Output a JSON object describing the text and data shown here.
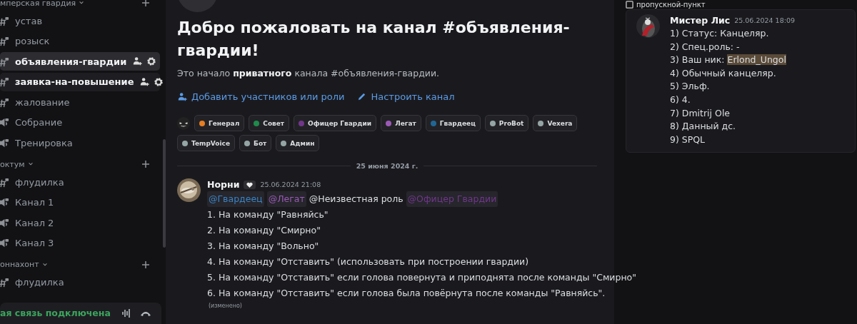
{
  "sidebar": {
    "categories": [
      {
        "name": "мперская гвардия",
        "channels": [
          {
            "kind": "text",
            "name": "устав",
            "selected": false,
            "unread": false
          },
          {
            "kind": "text",
            "name": "розыск",
            "selected": false,
            "unread": false
          },
          {
            "kind": "text",
            "name": "объявления-гвардии",
            "selected": true,
            "unread": true
          },
          {
            "kind": "text",
            "name": "заявка-на-повышение",
            "selected": false,
            "unread": true
          },
          {
            "kind": "text",
            "name": "жалование",
            "selected": false,
            "unread": false
          },
          {
            "kind": "voice",
            "name": "Собрание",
            "selected": false,
            "unread": false
          },
          {
            "kind": "voice",
            "name": "Тренировка",
            "selected": false,
            "unread": false
          }
        ]
      },
      {
        "name": "октум",
        "channels": [
          {
            "kind": "text",
            "name": "флудилка",
            "selected": false,
            "unread": false
          },
          {
            "kind": "voice",
            "name": "Канал 1",
            "selected": false,
            "unread": false
          },
          {
            "kind": "voice",
            "name": "Канал 2",
            "selected": false,
            "unread": false
          },
          {
            "kind": "voice",
            "name": "Канал 3",
            "selected": false,
            "unread": false
          }
        ]
      },
      {
        "name": "оннахонт",
        "channels": [
          {
            "kind": "text",
            "name": "флудилка",
            "selected": false,
            "unread": false
          }
        ]
      }
    ],
    "voice_status": "ая связь подключена"
  },
  "main": {
    "title": "Добро пожаловать на канал #объявления-гвардии!",
    "intro": "Это начало **приватного** канала #объявления-гвардии.",
    "actions": [
      "Добавить участников или роли",
      "Настроить канал"
    ],
    "roles": [
      {
        "name": "Генерал",
        "color": "#e67e22"
      },
      {
        "name": "Совет",
        "color": "#1f8b4c"
      },
      {
        "name": "Офицер Гвардии",
        "color": "#71368a"
      },
      {
        "name": "Легат",
        "color": "#9b59b6"
      },
      {
        "name": "Гвардеец",
        "color": "#206694"
      },
      {
        "name": "ProBot",
        "color": "#95a5a6"
      },
      {
        "name": "Vexera",
        "color": "#95a5a6"
      },
      {
        "name": "TempVoice",
        "color": "#95a5a6"
      },
      {
        "name": "Бот",
        "color": "#95a5a6"
      },
      {
        "name": "Админ",
        "color": "#95a5a6"
      }
    ],
    "date_divider": "25 июня 2024 г.",
    "message": {
      "author": "Норни",
      "time": "25.06.2024 21:08",
      "mentions": [
        {
          "kind": "role",
          "text": "@Гвардеец",
          "color": "#3b82c4"
        },
        {
          "kind": "role",
          "text": "@Легат",
          "color": "#9b59b6"
        },
        {
          "kind": "plain",
          "text": "@Неизвестная роль"
        },
        {
          "kind": "role",
          "text": "@Офицер Гвардии",
          "color": "#71368a"
        }
      ],
      "lines": [
        "1. На команду \"Равняйсь\"",
        "2. На команду \"Смирно\"",
        "3. На команду \"Вольно\"",
        "4. На команду \"Отставить\" (использовать при построении гвардии)",
        "5. На команду \"Отставить\" если голова повернута и приподнята после команды \"Смирно\"",
        "6. На команду \"Отставить\" если голова была повёрнута после команды \"Равняйсь\"."
      ],
      "edited": "(изменено)"
    }
  },
  "right_panel": {
    "header": "пропускной-пункт",
    "message": {
      "author": "Мистер Лис",
      "time": "25.06.2024 18:09",
      "lines": [
        {
          "text": "1) Статус: Канцеляр."
        },
        {
          "text": "2) Спец.роль: -"
        },
        {
          "text": "3) Ваш ник: ",
          "highlight": "Erlond_Ungol"
        },
        {
          "text": "4) Обычный канцеляр."
        },
        {
          "text": "5) Эльф."
        },
        {
          "text": "6) 4."
        },
        {
          "text": "7) Dmitrij Ole"
        },
        {
          "text": "8) Данный дс."
        },
        {
          "text": "9) SPQL"
        }
      ]
    }
  }
}
